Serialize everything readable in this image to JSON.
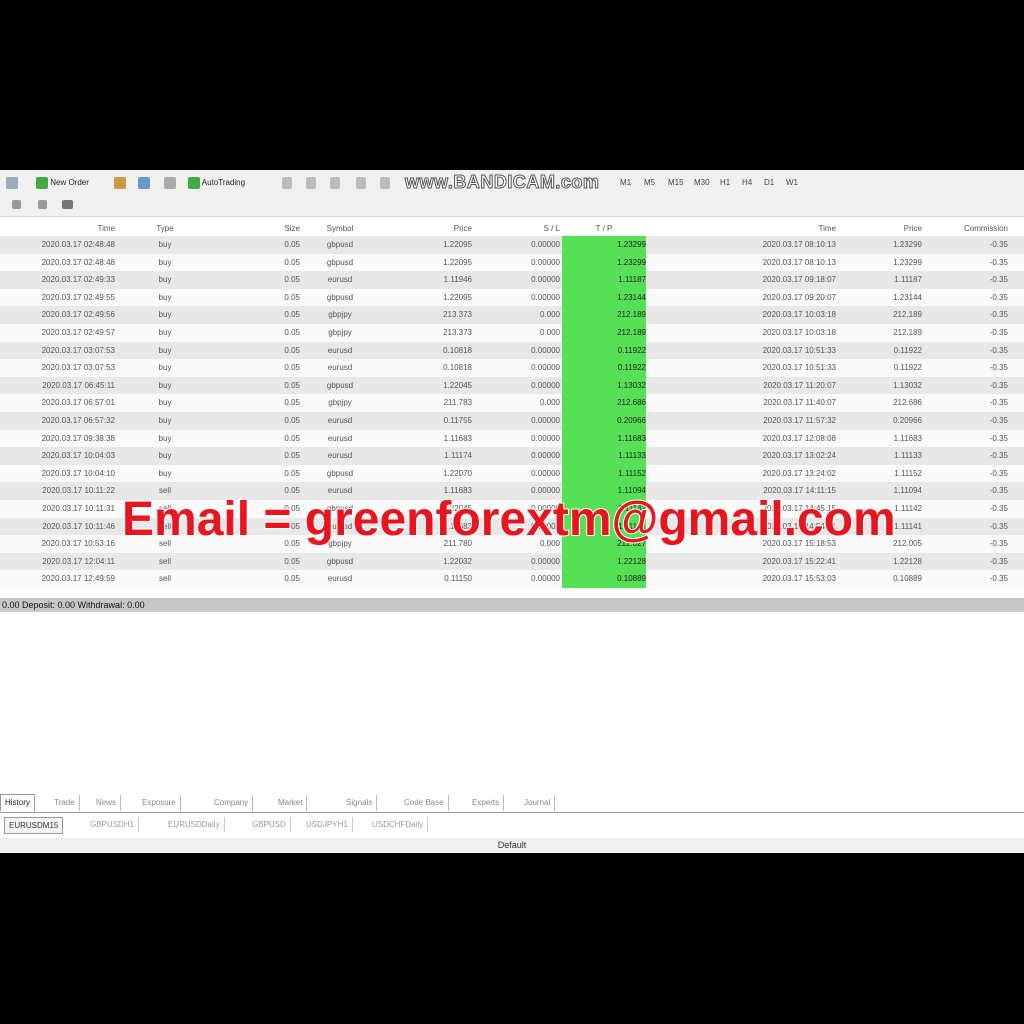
{
  "toolbar": {
    "new_order": "New Order",
    "auto_trading": "AutoTrading",
    "timeframes": [
      "M1",
      "M5",
      "M15",
      "M30",
      "H1",
      "H4",
      "D1",
      "W1",
      "MN"
    ],
    "watermark": "www.BANDICAM.com"
  },
  "table": {
    "headers": [
      "Time",
      "Type",
      "Size",
      "Symbol",
      "Price",
      "S / L",
      "T / P",
      "Time",
      "Price",
      "Commission"
    ],
    "rows": [
      [
        "2020.03.17 02:48:48",
        "buy",
        "0.05",
        "gbpusd",
        "1.22095",
        "0.00000",
        "1.23299",
        "2020.03.17 08:10:13",
        "1.23299",
        "-0.35"
      ],
      [
        "2020.03.17 02:48:48",
        "buy",
        "0.05",
        "gbpusd",
        "1.22095",
        "0.00000",
        "1.23299",
        "2020.03.17 08:10:13",
        "1.23299",
        "-0.35"
      ],
      [
        "2020.03.17 02:49:33",
        "buy",
        "0.05",
        "eurusd",
        "1.11946",
        "0.00000",
        "1.11187",
        "2020.03.17 09:18:07",
        "1.11187",
        "-0.35"
      ],
      [
        "2020.03.17 02:49:55",
        "buy",
        "0.05",
        "gbpusd",
        "1.22095",
        "0.00000",
        "1.23144",
        "2020.03.17 09:20:07",
        "1.23144",
        "-0.35"
      ],
      [
        "2020.03.17 02:49:56",
        "buy",
        "0.05",
        "gbpjpy",
        "213.373",
        "0.000",
        "212.189",
        "2020.03.17 10:03:18",
        "212.189",
        "-0.35"
      ],
      [
        "2020.03.17 02:49:57",
        "buy",
        "0.05",
        "gbpjpy",
        "213.373",
        "0.000",
        "212.189",
        "2020.03.17 10:03:18",
        "212.189",
        "-0.35"
      ],
      [
        "2020.03.17 03:07:53",
        "buy",
        "0.05",
        "eurusd",
        "0.10818",
        "0.00000",
        "0.11922",
        "2020.03.17 10:51:33",
        "0.11922",
        "-0.35"
      ],
      [
        "2020.03.17 03:07:53",
        "buy",
        "0.05",
        "eurusd",
        "0.10818",
        "0.00000",
        "0.11922",
        "2020.03.17 10:51:33",
        "0.11922",
        "-0.35"
      ],
      [
        "2020.03.17 06:45:11",
        "buy",
        "0.05",
        "gbpusd",
        "1.22045",
        "0.00000",
        "1.13032",
        "2020.03.17 11:20:07",
        "1.13032",
        "-0.35"
      ],
      [
        "2020.03.17 06:57:01",
        "buy",
        "0.05",
        "gbpjpy",
        "211.783",
        "0.000",
        "212.686",
        "2020.03.17 11:40:07",
        "212.686",
        "-0.35"
      ],
      [
        "2020.03.17 06:57:32",
        "buy",
        "0.05",
        "eurusd",
        "0.11755",
        "0.00000",
        "0.20966",
        "2020.03.17 11:57:32",
        "0.20966",
        "-0.35"
      ],
      [
        "2020.03.17 09:38:38",
        "buy",
        "0.05",
        "eurusd",
        "1.11683",
        "0.00000",
        "1.11683",
        "2020.03.17 12:08:08",
        "1.11683",
        "-0.35"
      ],
      [
        "2020.03.17 10:04:03",
        "buy",
        "0.05",
        "eurusd",
        "1.11174",
        "0.00000",
        "1.11133",
        "2020.03.17 13:02:24",
        "1.11133",
        "-0.35"
      ],
      [
        "2020.03.17 10:04:10",
        "buy",
        "0.05",
        "gbpusd",
        "1.22070",
        "0.00000",
        "1.11152",
        "2020.03.17 13:24:02",
        "1.11152",
        "-0.35"
      ],
      [
        "2020.03.17 10:11:22",
        "sell",
        "0.05",
        "eurusd",
        "1.11683",
        "0.00000",
        "1.11094",
        "2020.03.17 14:11:15",
        "1.11094",
        "-0.35"
      ],
      [
        "2020.03.17 10:11:31",
        "sell",
        "0.05",
        "gbpusd",
        "1.22045",
        "0.00000",
        "1.11142",
        "2020.03.17 14:45:15",
        "1.11142",
        "-0.35"
      ],
      [
        "2020.03.17 10:11:46",
        "sell",
        "0.05",
        "eurusd",
        "1.11683",
        "0.00000",
        "1.11141",
        "2020.03.17 14:54:21",
        "1.11141",
        "-0.35"
      ],
      [
        "2020.03.17 10:53:16",
        "sell",
        "0.05",
        "gbpjpy",
        "211.780",
        "0.000",
        "212.027",
        "2020.03.17 15:18:53",
        "212.005",
        "-0.35"
      ],
      [
        "2020.03.17 12:04:11",
        "sell",
        "0.05",
        "gbpusd",
        "1.22032",
        "0.00000",
        "1.22128",
        "2020.03.17 15:22:41",
        "1.22128",
        "-0.35"
      ],
      [
        "2020.03.17 12:49:59",
        "sell",
        "0.05",
        "eurusd",
        "0.11150",
        "0.00000",
        "0.10889",
        "2020.03.17 15:53:03",
        "0.10889",
        "-0.35"
      ]
    ]
  },
  "balance_line": "0.00  Deposit: 0.00  Withdrawal: 0.00",
  "overlay_email": "Email = greenforextm@gmail.com",
  "tabs": [
    "History",
    "Trade",
    "News",
    "Exposure",
    "Company",
    "Market",
    "Signals",
    "Code Base",
    "Experts",
    "Journal"
  ],
  "subtabs": [
    "EURUSDM15",
    "GBPUSDH1",
    "EURUSDDaily",
    "GBPUSD",
    "USDJPYH1",
    "USDCHFDaily"
  ],
  "status_text": "Default",
  "colors": {
    "tp_highlight": "#55e055",
    "email_text": "#e8141e"
  }
}
